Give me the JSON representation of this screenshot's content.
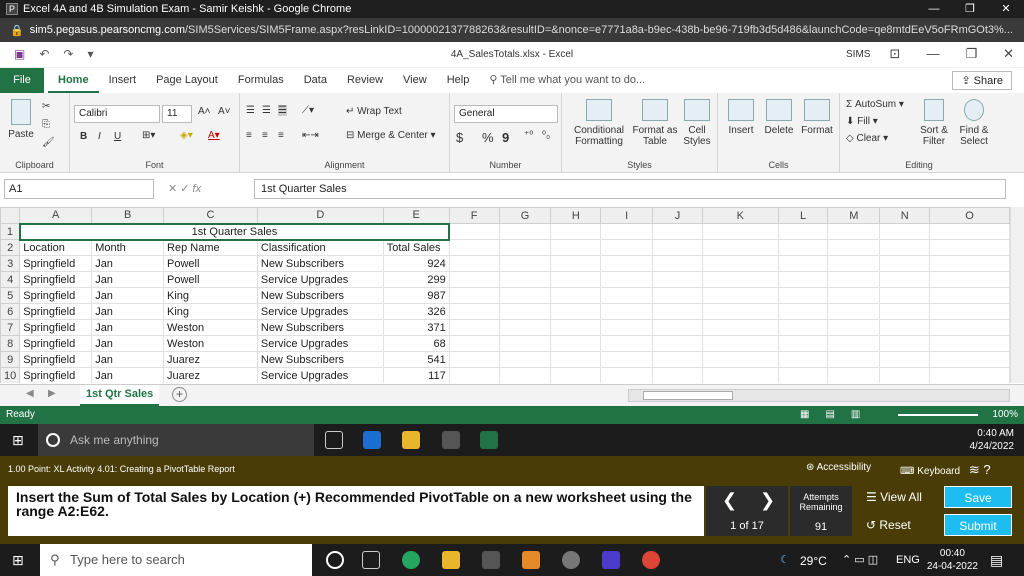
{
  "chrome": {
    "title": "Excel 4A and 4B Simulation Exam - Samir Keishk - Google Chrome",
    "favicon": "P",
    "url_host": "sim5.pegasus.pearsoncmg.com",
    "url_path": "/SIM5Services/SIM5Frame.aspx?resLinkID=1000002137788263&resultID=&nonce=e7771a8a-b9ec-438b-be96-719fb3d5d486&launchCode=qe8mtdEeV5oFRmGOt3%..."
  },
  "excel": {
    "file_title": "4A_SalesTotals.xlsx - Excel",
    "sims_label": "SIMS",
    "tabs": [
      "File",
      "Home",
      "Insert",
      "Page Layout",
      "Formulas",
      "Data",
      "Review",
      "View",
      "Help"
    ],
    "tell_me": "Tell me what you want to do...",
    "share": "Share"
  },
  "ribbon": {
    "clipboard": {
      "paste": "Paste",
      "label": "Clipboard"
    },
    "font": {
      "name": "Calibri",
      "size": "11",
      "label": "Font",
      "bold": "B",
      "italic": "I",
      "underline": "U"
    },
    "alignment": {
      "wrap": "Wrap Text",
      "merge": "Merge & Center",
      "label": "Alignment"
    },
    "number": {
      "format": "General",
      "currency": "$",
      "percent": "%",
      "comma": "9",
      "label": "Number"
    },
    "styles": {
      "conditional": "Conditional Formatting",
      "format_table": "Format as Table",
      "cell_styles": "Cell Styles",
      "label": "Styles"
    },
    "cells": {
      "insert": "Insert",
      "delete": "Delete",
      "format": "Format",
      "label": "Cells"
    },
    "editing": {
      "autosum": "AutoSum",
      "fill": "Fill",
      "clear": "Clear",
      "sort": "Sort & Filter",
      "find": "Find & Select",
      "label": "Editing"
    }
  },
  "formula_bar": {
    "name_box": "A1",
    "fx": "fx",
    "content": "1st Quarter Sales"
  },
  "grid": {
    "columns": [
      "A",
      "B",
      "C",
      "D",
      "E",
      "F",
      "G",
      "H",
      "I",
      "J",
      "K",
      "L",
      "M",
      "N",
      "O"
    ],
    "title": "1st Quarter Sales",
    "headers": [
      "Location",
      "Month",
      "Rep Name",
      "Classification",
      "Total Sales"
    ],
    "rows": [
      [
        "Springfield",
        "Jan",
        "Powell",
        "New Subscribers",
        "924"
      ],
      [
        "Springfield",
        "Jan",
        "Powell",
        "Service Upgrades",
        "299"
      ],
      [
        "Springfield",
        "Jan",
        "King",
        "New Subscribers",
        "987"
      ],
      [
        "Springfield",
        "Jan",
        "King",
        "Service Upgrades",
        "326"
      ],
      [
        "Springfield",
        "Jan",
        "Weston",
        "New Subscribers",
        "371"
      ],
      [
        "Springfield",
        "Jan",
        "Weston",
        "Service Upgrades",
        "68"
      ],
      [
        "Springfield",
        "Jan",
        "Juarez",
        "New Subscribers",
        "541"
      ],
      [
        "Springfield",
        "Jan",
        "Juarez",
        "Service Upgrades",
        "117"
      ]
    ]
  },
  "sheet_tab": "1st Qtr Sales",
  "status": {
    "ready": "Ready",
    "zoom": "100%"
  },
  "inner_taskbar": {
    "ask": "Ask me anything",
    "time": "0:40 AM",
    "date": "4/24/2022"
  },
  "sim": {
    "point": "1.00 Point: XL Activity 4.01: Creating a PivotTable Report",
    "accessibility": "Accessibility",
    "keyboard": "Keyboard",
    "instruction": "Insert the Sum of Total Sales by Location (+) Recommended PivotTable on a new worksheet using the range A2:E62.",
    "counter": "1 of 17",
    "attempts_label": "Attempts Remaining",
    "attempts": "91",
    "view_all": "View All",
    "reset": "Reset",
    "save": "Save",
    "submit": "Submit"
  },
  "os_taskbar": {
    "search": "Type here to search",
    "temp": "29°C",
    "lang": "ENG",
    "time": "00:40",
    "date": "24-04-2022"
  },
  "colors": {
    "excel_green": "#217346",
    "sim_bg": "#4a3c07",
    "accent_blue": "#1ebdf0"
  }
}
